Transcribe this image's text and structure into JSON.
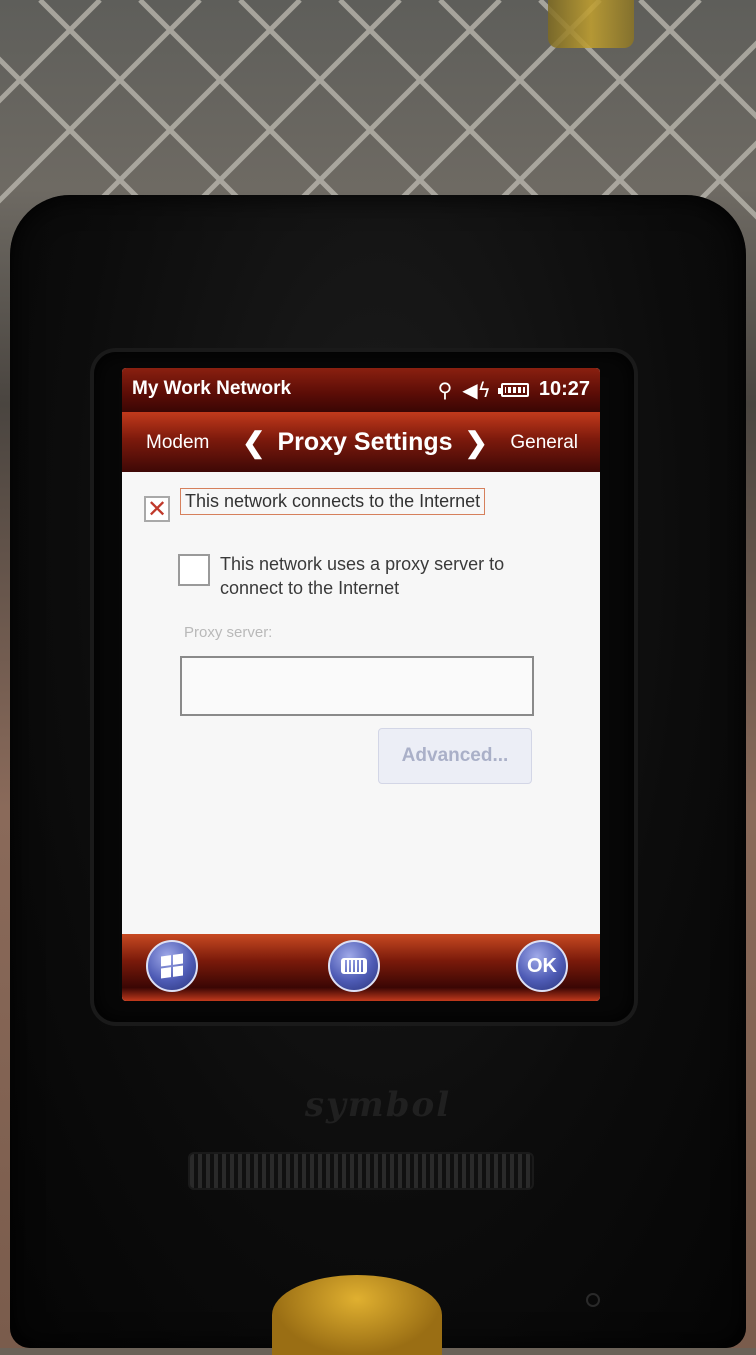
{
  "status_bar": {
    "app_title": "My Work Network",
    "time": "10:27",
    "icons": [
      "connectivity-icon",
      "speaker-muted-icon",
      "battery-icon"
    ]
  },
  "tabs": {
    "previous": "Modem",
    "current": "Proxy Settings",
    "next": "General"
  },
  "settings": {
    "connects_internet_label": "This network connects to the Internet",
    "connects_internet_checked": true,
    "uses_proxy_label": "This network uses a proxy server to connect to the Internet",
    "uses_proxy_checked": false,
    "proxy_server_label": "Proxy server:",
    "proxy_server_value": "",
    "advanced_button": "Advanced..."
  },
  "soft_keys": {
    "start": "start-icon",
    "keyboard": "keyboard-icon",
    "ok": "OK"
  },
  "device": {
    "brand": "symbol"
  },
  "colors": {
    "accent": "#7d1a0c",
    "checkmark": "#c0392b",
    "button_round": "#4e5bb5"
  }
}
